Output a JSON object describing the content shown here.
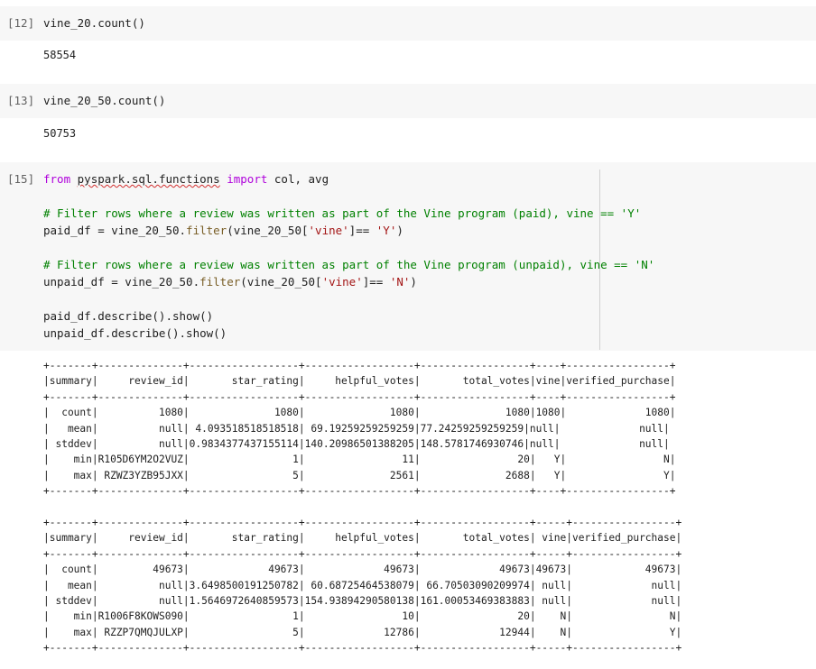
{
  "cells": [
    {
      "prompt": "[12]",
      "code": "vine_20.count()",
      "output": "58554"
    },
    {
      "prompt": "[13]",
      "code": "vine_20_50.count()",
      "output": "50753"
    },
    {
      "prompt": "[15]",
      "code_lines": {
        "l1_kw1": "from",
        "l1_mod": "pyspark.sql.functions",
        "l1_kw2": "import",
        "l1_rest": "col, avg",
        "l2_comment": "# Filter rows where a review was written as part of the Vine program (paid), vine == 'Y'",
        "l3_a": "paid_df = vine_20_50.",
        "l3_fn": "filter",
        "l3_b": "(vine_20_50[",
        "l3_str1": "'vine'",
        "l3_c": "]== ",
        "l3_str2": "'Y'",
        "l3_d": ")",
        "l4_comment": "# Filter rows where a review was written as part of the Vine program (unpaid), vine == 'N'",
        "l5_a": "unpaid_df = vine_20_50.",
        "l5_fn": "filter",
        "l5_b": "(vine_20_50[",
        "l5_str1": "'vine'",
        "l5_c": "]== ",
        "l5_str2": "'N'",
        "l5_d": ")",
        "l6": "paid_df.describe().show()",
        "l7": "unpaid_df.describe().show()"
      },
      "output_paid": "+-------+--------------+------------------+------------------+------------------+----+-----------------+\n|summary|     review_id|       star_rating|     helpful_votes|       total_votes|vine|verified_purchase|\n+-------+--------------+------------------+------------------+------------------+----+-----------------+\n|  count|          1080|              1080|              1080|              1080|1080|             1080|\n|   mean|          null| 4.093518518518518| 69.19259259259259|77.24259259259259|null|             null|\n| stddev|          null|0.9834377437155114|140.20986501388205|148.5781746930746|null|             null|\n|    min|R105D6YM2O2VUZ|                 1|                11|                20|   Y|                N|\n|    max| RZWZ3YZB95JXX|                 5|              2561|              2688|   Y|                Y|\n+-------+--------------+------------------+------------------+------------------+----+-----------------+",
      "output_unpaid": "+-------+--------------+------------------+------------------+------------------+-----+-----------------+\n|summary|     review_id|       star_rating|     helpful_votes|       total_votes| vine|verified_purchase|\n+-------+--------------+------------------+------------------+------------------+-----+-----------------+\n|  count|         49673|             49673|             49673|             49673|49673|            49673|\n|   mean|          null|3.6498500191250782| 60.68725464538079| 66.70503090209974| null|             null|\n| stddev|          null|1.5646972640859573|154.93894290580138|161.00053469383883| null|             null|\n|    min|R1006F8KOWS090|                 1|                10|                20|    N|                N|\n|    max| RZZP7QMQJULXP|                 5|             12786|             12944|    N|                Y|\n+-------+--------------+------------------+------------------+------------------+-----+-----------------+"
    }
  ]
}
